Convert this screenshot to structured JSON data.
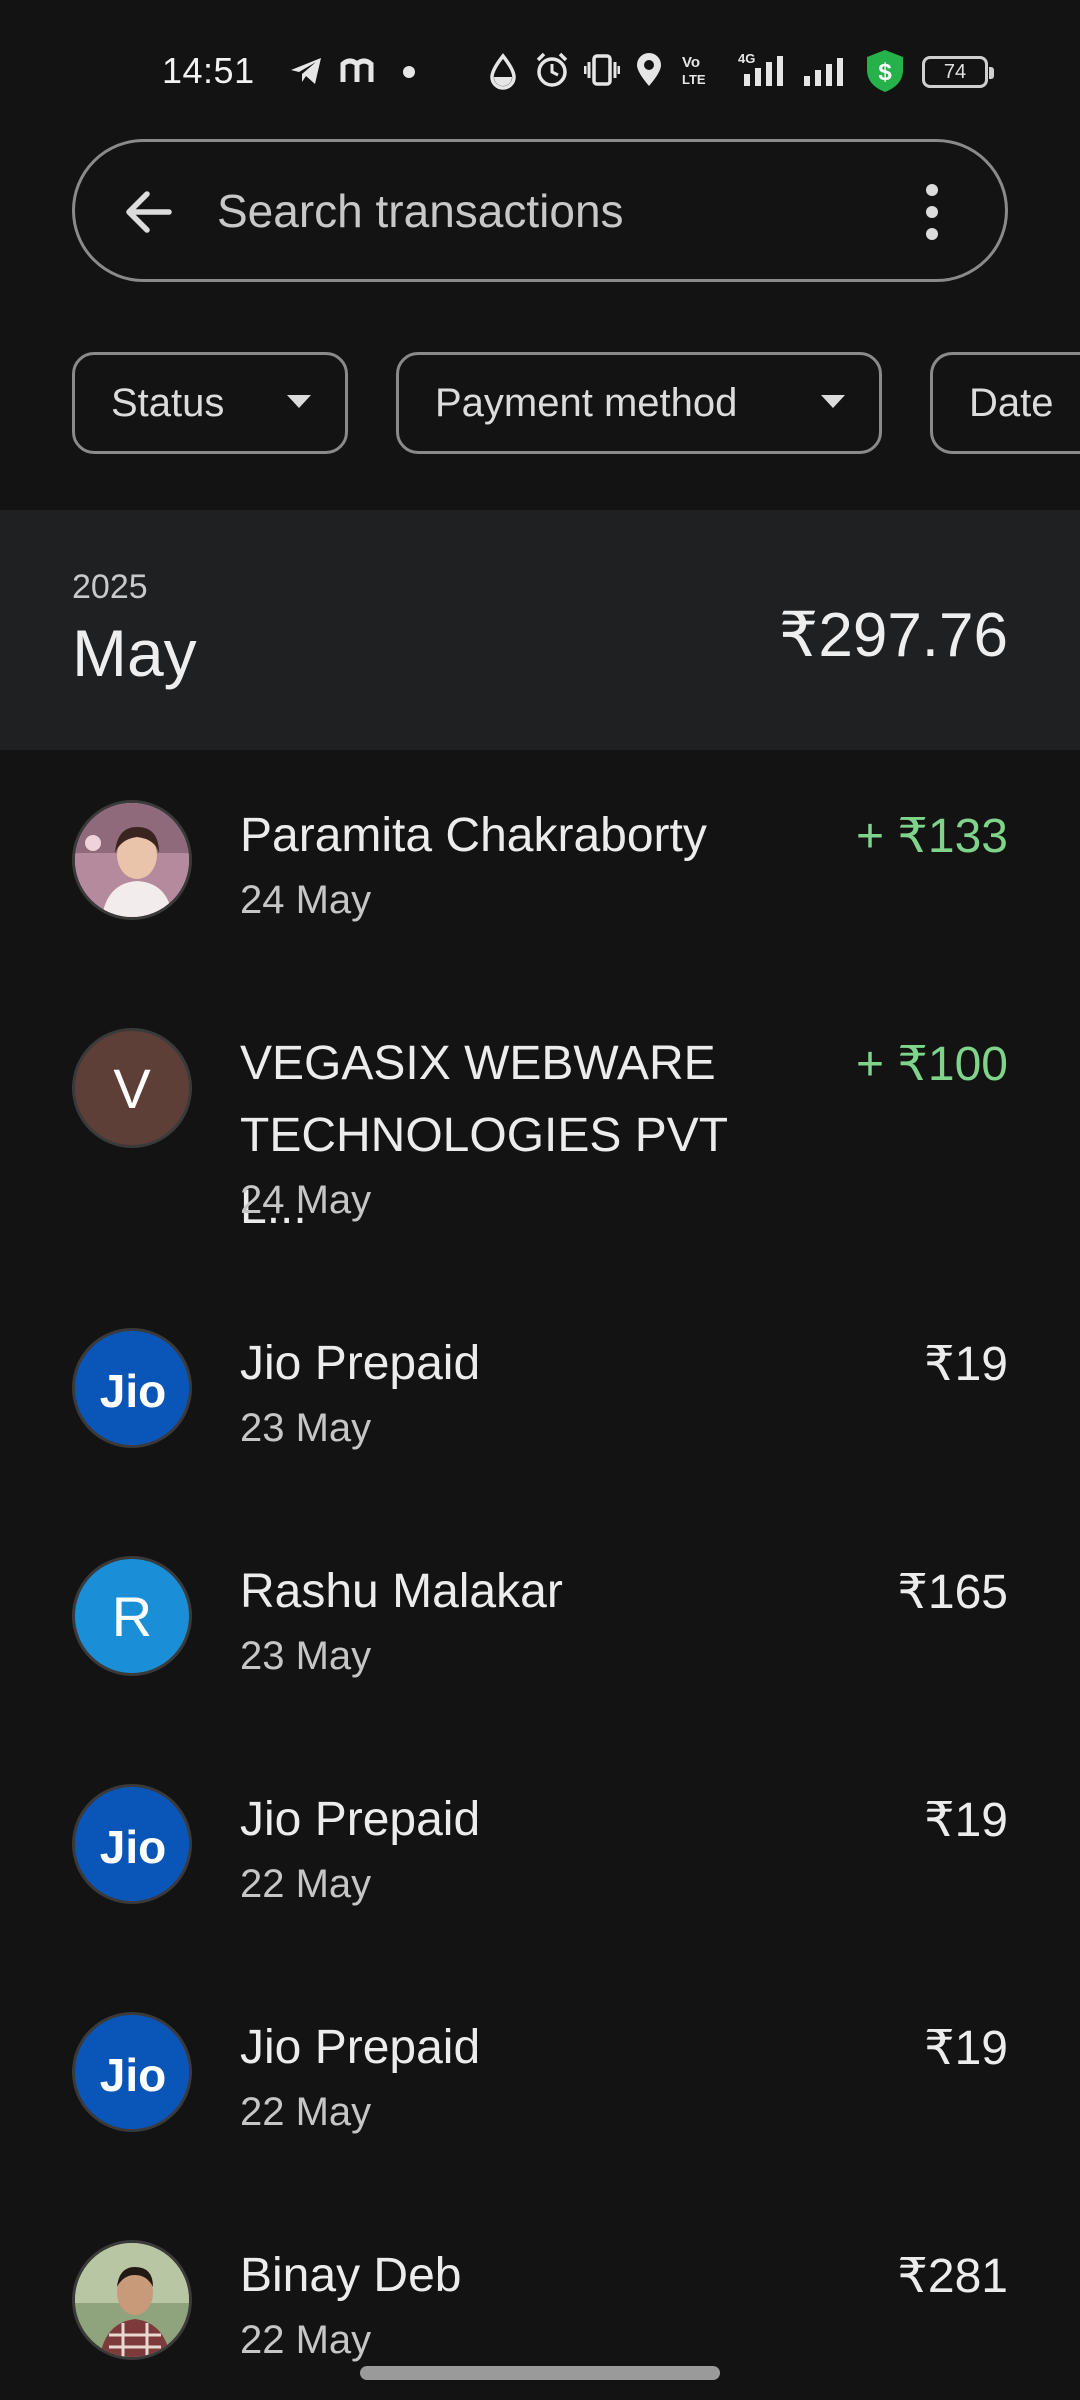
{
  "status_bar": {
    "time": "14:51",
    "battery": "74",
    "icons": [
      "telegram-icon",
      "m-app-icon",
      "dot-icon",
      "drop-icon",
      "alarm-icon",
      "vibrate-icon",
      "location-icon",
      "volte-icon",
      "4g-signal-icon",
      "signal-icon",
      "shield-dollar-icon",
      "battery-icon"
    ]
  },
  "search": {
    "placeholder": "Search transactions"
  },
  "filters": [
    {
      "label": "Status"
    },
    {
      "label": "Payment method"
    },
    {
      "label": "Date"
    }
  ],
  "month_group": {
    "year": "2025",
    "month": "May",
    "total": "₹297.76"
  },
  "transactions": [
    {
      "name": "Paramita Chakraborty",
      "date": "24 May",
      "amount": "+ ₹133",
      "type": "credit",
      "avatar": "photo"
    },
    {
      "name": "VEGASIX WEBWARE TECHNOLOGIES PVT L...",
      "date": "24 May",
      "amount": "+ ₹100",
      "type": "credit",
      "avatar": "V",
      "avatar_color": "#5d3f38"
    },
    {
      "name": "Jio Prepaid",
      "date": "23 May",
      "amount": "₹19",
      "type": "debit",
      "avatar": "Jio"
    },
    {
      "name": "Rashu Malakar",
      "date": "23 May",
      "amount": "₹165",
      "type": "debit",
      "avatar": "R",
      "avatar_color": "#1a8fd8"
    },
    {
      "name": "Jio Prepaid",
      "date": "22 May",
      "amount": "₹19",
      "type": "debit",
      "avatar": "Jio"
    },
    {
      "name": "Jio Prepaid",
      "date": "22 May",
      "amount": "₹19",
      "type": "debit",
      "avatar": "Jio"
    },
    {
      "name": "Binay Deb",
      "date": "22 May",
      "amount": "₹281",
      "type": "debit",
      "avatar": "photo"
    }
  ],
  "colors": {
    "background": "#131313",
    "header_band": "#1f2022",
    "credit": "#7fd38a",
    "jio_blue": "#0a56b8"
  }
}
